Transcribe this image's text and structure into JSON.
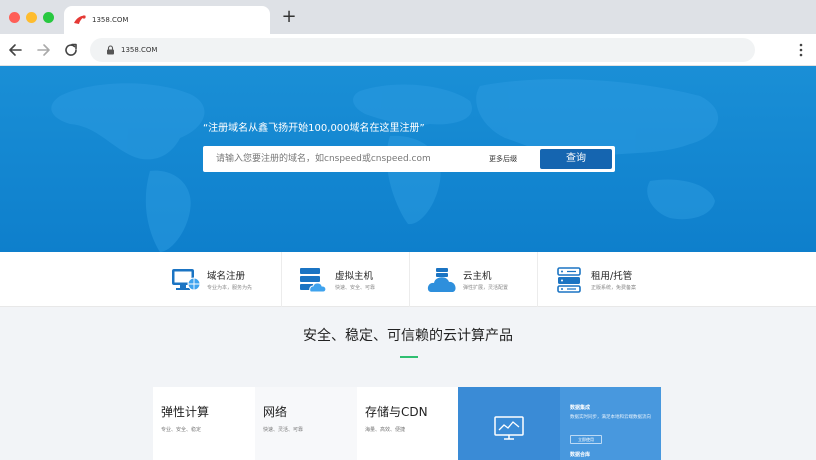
{
  "browser": {
    "tab_title": "1358.COM",
    "new_tab": "+",
    "url": "1358.COM",
    "icons": {
      "traffic_lights": [
        "close-window",
        "minimize-window",
        "zoom-window"
      ],
      "back": "arrow-left-icon",
      "forward": "arrow-right-icon",
      "reload": "reload-icon",
      "lock": "lock-icon",
      "menu": "kebab-menu-icon"
    }
  },
  "hero": {
    "slogan": "“注册域名从鑫飞扬开始100,000域名在这里注册”",
    "search": {
      "placeholder": "请输入您要注册的域名，如cnspeed或cnspeed.com",
      "more_suffix": "更多后缀",
      "button_label": "查询"
    }
  },
  "services": [
    {
      "name": "域名注册",
      "desc": "专业为本，服务为先",
      "icon": "monitor-globe-icon"
    },
    {
      "name": "虚拟主机",
      "desc": "快速、安全、可靠",
      "icon": "server-cloud-icon"
    },
    {
      "name": "云主机",
      "desc": "弹性扩展，灵活配置",
      "icon": "cloud-server-icon"
    },
    {
      "name": "租用/托管",
      "desc": "正版系统，免费备案",
      "icon": "rack-server-icon"
    }
  ],
  "products": {
    "title": "安全、稳定、可信赖的云计算产品",
    "cards": [
      {
        "title": "弹性计算",
        "desc": "专业、安全、稳定"
      },
      {
        "title": "网络",
        "desc": "快速、灵活、可靠"
      },
      {
        "title": "存储与CDN",
        "desc": "海量、高效、便捷"
      }
    ],
    "feature": {
      "icon": "monitor-chart-icon",
      "title": "数据集成",
      "desc": "数据实时同步，满足本地和云端数据流向",
      "button": "立即使用",
      "title2": "数据合库"
    }
  },
  "colors": {
    "hero_blue": "#0e7fcc",
    "button_blue": "#1565b0",
    "accent_green": "#2fbf71",
    "feature_blue": "#3d8fd9"
  }
}
